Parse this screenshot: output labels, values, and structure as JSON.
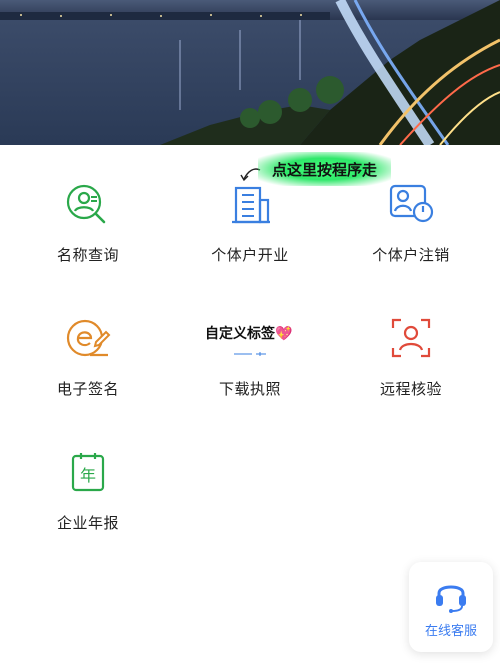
{
  "annotation": {
    "sticker_text": "点这里按程序走",
    "custom_tag_text": "自定义标签💖"
  },
  "services": [
    {
      "label": "名称查询",
      "icon": "person-search-icon",
      "color": "#2aa84a"
    },
    {
      "label": "个体户开业",
      "icon": "building-icon",
      "color": "#3a7fe0"
    },
    {
      "label": "个体户注销",
      "icon": "person-power-icon",
      "color": "#3a7fe0"
    },
    {
      "label": "电子签名",
      "icon": "e-sign-icon",
      "color": "#e08a2a"
    },
    {
      "label": "下载执照",
      "icon": "download-license-icon",
      "color": "#3a7fe0"
    },
    {
      "label": "远程核验",
      "icon": "face-verify-icon",
      "color": "#e04a3a"
    },
    {
      "label": "企业年报",
      "icon": "annual-report-icon",
      "color": "#2aa84a"
    }
  ],
  "customer_service": {
    "label": "在线客服",
    "icon": "headset-icon",
    "color": "#3b7cf0"
  },
  "annual_report_glyph": "年"
}
